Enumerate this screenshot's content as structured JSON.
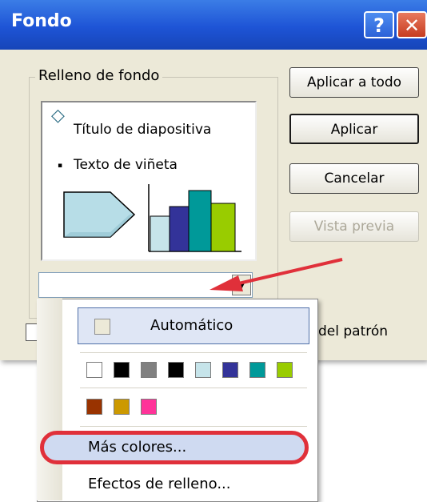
{
  "dialog": {
    "title": "Fondo",
    "help_glyph": "?",
    "close_glyph": "✕"
  },
  "group": {
    "label": "Relleno de fondo",
    "preview": {
      "title": "Título de diapositiva",
      "bullet": "Texto de viñeta",
      "title_bullet_glyph": "◇",
      "bullet_glyph": "▪"
    },
    "combo_arrow_glyph": "▼"
  },
  "buttons": {
    "apply_all": "Aplicar a todo",
    "apply": "Aplicar",
    "cancel": "Cancelar",
    "preview": "Vista previa"
  },
  "checkbox": {
    "label": "del patrón"
  },
  "menu": {
    "auto_label": "Automático",
    "more_colors": "Más colores...",
    "fill_effects": "Efectos de relleno...",
    "palette_row1": [
      "#ffffff",
      "#000000",
      "#808080",
      "#000000",
      "#c6e4ea",
      "#333399",
      "#009999",
      "#99cc00"
    ],
    "palette_row2": [
      "#993300",
      "#cc9900",
      "#ff3399"
    ]
  },
  "colors": {
    "titlebar": "#1e54d6",
    "annotation_red": "#e0303a",
    "dialog_bg": "#ece9d8"
  }
}
